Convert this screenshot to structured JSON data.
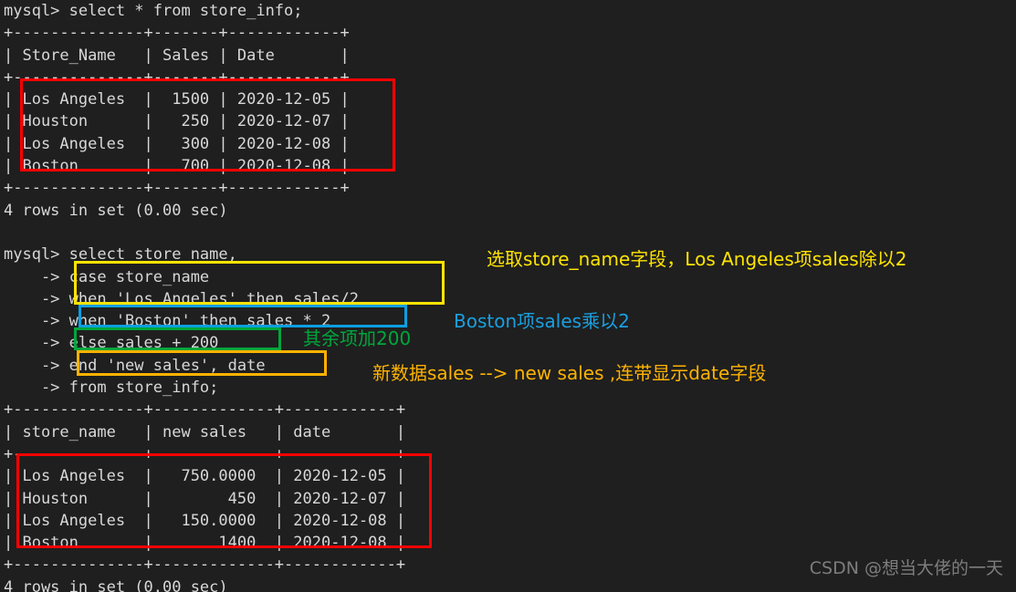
{
  "terminal": {
    "background_color": "#1f1f1f",
    "text_color": "#d8d8d8",
    "lines": [
      "mysql> select * from store_info;",
      "+--------------+-------+------------+",
      "| Store_Name   | Sales | Date       |",
      "+--------------+-------+------------+",
      "| Los Angeles  |  1500 | 2020-12-05 |",
      "| Houston      |   250 | 2020-12-07 |",
      "| Los Angeles  |   300 | 2020-12-08 |",
      "| Boston       |   700 | 2020-12-08 |",
      "+--------------+-------+------------+",
      "4 rows in set (0.00 sec)",
      "",
      "mysql> select store_name,",
      "    -> case store_name",
      "    -> when 'Los Angeles' then sales/2",
      "    -> when 'Boston' then sales * 2",
      "    -> else sales + 200",
      "    -> end 'new sales', date",
      "    -> from store_info;",
      "+--------------+-------------+------------+",
      "| store_name   | new sales   | date       |",
      "+--------------+-------------+------------+",
      "| Los Angeles  |   750.0000  | 2020-12-05 |",
      "| Houston      |        450  | 2020-12-07 |",
      "| Los Angeles  |   150.0000  | 2020-12-08 |",
      "| Boston       |       1400  | 2020-12-08 |",
      "+--------------+-------------+------------+",
      "4 rows in set (0.00 sec)"
    ]
  },
  "query1": {
    "statement": "select * from store_info;",
    "columns": [
      "Store_Name",
      "Sales",
      "Date"
    ],
    "rows": [
      [
        "Los Angeles",
        "1500",
        "2020-12-05"
      ],
      [
        "Houston",
        "250",
        "2020-12-07"
      ],
      [
        "Los Angeles",
        "300",
        "2020-12-08"
      ],
      [
        "Boston",
        "700",
        "2020-12-08"
      ]
    ],
    "result_status": "4 rows in set (0.00 sec)"
  },
  "query2": {
    "statement_lines": [
      "select store_name,",
      "case store_name",
      "when 'Los Angeles' then sales/2",
      "when 'Boston' then sales * 2",
      "else sales + 200",
      "end 'new sales', date",
      "from store_info;"
    ],
    "columns": [
      "store_name",
      "new sales",
      "date"
    ],
    "rows": [
      [
        "Los Angeles",
        "750.0000",
        "2020-12-05"
      ],
      [
        "Houston",
        "450",
        "2020-12-07"
      ],
      [
        "Los Angeles",
        "150.0000",
        "2020-12-08"
      ],
      [
        "Boston",
        "1400",
        "2020-12-08"
      ]
    ],
    "result_status": "4 rows in set (0.00 sec)"
  },
  "annotations": [
    {
      "id": "note-case-la",
      "text": "选取store_name字段，Los Angeles项sales除以2",
      "color": "#ffe400"
    },
    {
      "id": "note-boston",
      "text": "Boston项sales乘以2",
      "color": "#1a9fe0"
    },
    {
      "id": "note-else",
      "text": "其余项加200",
      "color": "#00a63c"
    },
    {
      "id": "note-alias",
      "text": "新数据sales --> new sales ,连带显示date字段",
      "color": "#ffb300"
    }
  ],
  "highlight_boxes": [
    {
      "id": "box-result1",
      "color": "#ff0000",
      "target": "first-result-rows"
    },
    {
      "id": "box-case-when-la",
      "color": "#ffe400",
      "target": "case-and-when-los-angeles"
    },
    {
      "id": "box-when-boston",
      "color": "#0c9fe0",
      "target": "when-boston"
    },
    {
      "id": "box-else",
      "color": "#00a63c",
      "target": "else-sales-plus-200"
    },
    {
      "id": "box-end-alias",
      "color": "#ffb300",
      "target": "end-new-sales-date"
    },
    {
      "id": "box-result2",
      "color": "#ff0000",
      "target": "second-result-rows"
    }
  ],
  "watermark": {
    "text": "CSDN @想当大佬的一天"
  }
}
